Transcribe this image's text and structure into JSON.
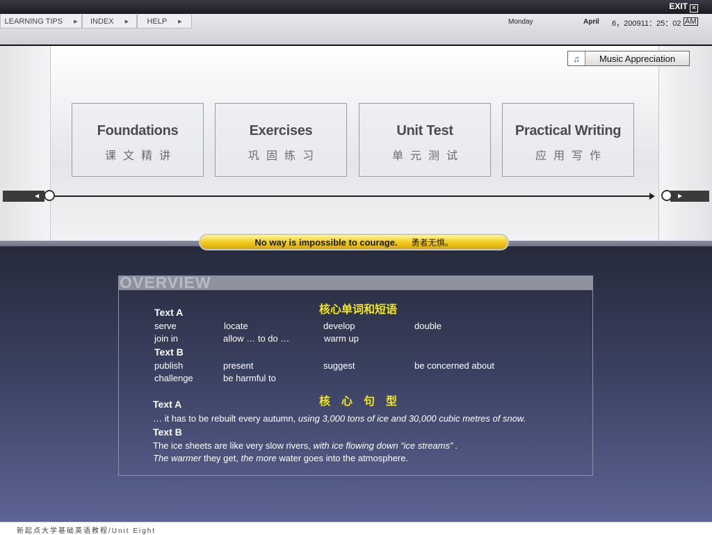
{
  "topbar": {
    "exit_label": "EXIT",
    "exit_glyph": "✕"
  },
  "menu": {
    "items": [
      {
        "label": "LEARNING TIPS"
      },
      {
        "label": "INDEX"
      },
      {
        "label": "HELP"
      }
    ],
    "arrow_glyph": "▶"
  },
  "datetime": {
    "weekday": "Monday",
    "month": "April",
    "date": "6，200911：25：02",
    "ampm": "AM"
  },
  "music_button": {
    "label": "Music Appreciation",
    "icon": "music-note-icon"
  },
  "cards": [
    {
      "en": "Foundations",
      "cn": "课文精讲"
    },
    {
      "en": "Exercises",
      "cn": "巩固练习"
    },
    {
      "en": "Unit Test",
      "cn": "单元测试"
    },
    {
      "en": "Practical Writing",
      "cn": "应用写作"
    }
  ],
  "motto": {
    "en": "No way is impossible to courage.",
    "cn": "勇者无惧。"
  },
  "overview": {
    "title": "OVERVIEW",
    "vocab_heading": "核心单词和短语",
    "text_a_label": "Text A",
    "text_a_words": [
      "serve",
      "locate",
      "develop",
      "double",
      "join in",
      "allow … to do …",
      "warm up"
    ],
    "text_b_label": "Text B",
    "text_b_words": [
      "publish",
      "present",
      "suggest",
      "be concerned about",
      "challenge",
      "be harmful to"
    ],
    "sentence_heading": "核　心　句　型",
    "s_text_a_label": "Text A",
    "s_a_plain": "… it has to be rebuilt every autumn, ",
    "s_a_italic": "using 3,000 tons of ice and 30,000 cubic metres of snow.",
    "s_text_b_label": "Text B",
    "s_b1_plain": "The ice sheets are like very slow rivers, ",
    "s_b1_italic": "with ice flowing down",
    "s_b1_tail": "  “ice streams” .",
    "s_b2_i1": "The warmer",
    "s_b2_p1": " they get, ",
    "s_b2_i2": "the more",
    "s_b2_p2": " water goes into the atmosphere."
  },
  "footer": {
    "text": "新起点大学基础英语教程/Unit Eight"
  }
}
